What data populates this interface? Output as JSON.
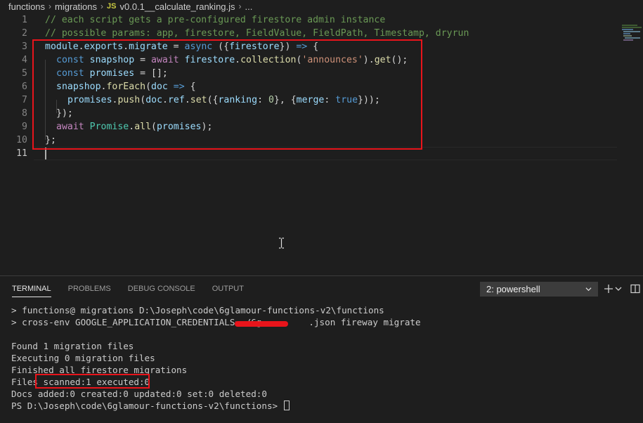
{
  "breadcrumb": {
    "items": [
      "functions",
      "migrations"
    ],
    "file_badge": "JS",
    "file_name": "v0.0.1__calculate_ranking.js",
    "ellipsis": "..."
  },
  "editor": {
    "line_numbers": [
      "1",
      "2",
      "3",
      "4",
      "5",
      "6",
      "7",
      "8",
      "9",
      "10",
      "11"
    ],
    "lines": {
      "l1": "// each script gets a pre-configured firestore admin instance",
      "l2": "// possible params: app, firestore, FieldValue, FieldPath, Timestamp, dryrun",
      "l3": {
        "a": "module",
        "b": ".",
        "c": "exports",
        "d": ".",
        "e": "migrate",
        "f": " = ",
        "g": "async",
        "h": " ({",
        "i": "firestore",
        "j": "}) ",
        "k": "=>",
        "l": " {"
      },
      "l4": {
        "a": "const",
        "b": " ",
        "c": "snapshop",
        "d": " = ",
        "e": "await",
        "f": " ",
        "g": "firestore",
        "h": ".",
        "i": "collection",
        "j": "(",
        "k": "'announces'",
        "l": ").",
        "m": "get",
        "n": "();"
      },
      "l5": {
        "a": "const",
        "b": " ",
        "c": "promises",
        "d": " = [];"
      },
      "l6": {
        "a": "snapshop",
        "b": ".",
        "c": "forEach",
        "d": "(",
        "e": "doc",
        "f": " ",
        "g": "=>",
        "h": " {"
      },
      "l7": {
        "a": "promises",
        "b": ".",
        "c": "push",
        "d": "(",
        "e": "doc",
        "f": ".",
        "g": "ref",
        "h": ".",
        "i": "set",
        "j": "({",
        "k": "ranking",
        "l": ": ",
        "m": "0",
        "n": "}, {",
        "o": "merge",
        "p": ": ",
        "q": "true",
        "r": "}));"
      },
      "l8": "});",
      "l9": {
        "a": "await",
        "b": " ",
        "c": "Promise",
        "d": ".",
        "e": "all",
        "f": "(",
        "g": "promises",
        "h": ");"
      },
      "l10": "};"
    }
  },
  "panel": {
    "tabs": [
      "TERMINAL",
      "PROBLEMS",
      "DEBUG CONSOLE",
      "OUTPUT"
    ],
    "terminal_select": "2: powershell",
    "icons": [
      "plus-icon",
      "chevron-down-icon",
      "split-icon"
    ]
  },
  "terminal": {
    "lines": [
      "> functions@ migrations D:\\Joseph\\code\\6glamour-functions-v2\\functions",
      "> cross-env GOOGLE_APPLICATION_CREDENTIALS=./6g",
      ".json fireway migrate",
      "Found 1 migration files",
      "Executing 0 migration files",
      "Finished all firestore migrations",
      "Files ",
      "scanned:1 executed:0",
      "Docs added:0 created:0 updated:0 set:0 deleted:0",
      "PS D:\\Joseph\\code\\6glamour-functions-v2\\functions> "
    ]
  },
  "colors": {
    "background": "#1e1e1e",
    "highlight_box": "#e8141b",
    "comment": "#6a9955",
    "keyword": "#569cd6",
    "control": "#c586c0",
    "function": "#dcdcaa",
    "string": "#ce9178",
    "variable": "#9cdcfe"
  }
}
